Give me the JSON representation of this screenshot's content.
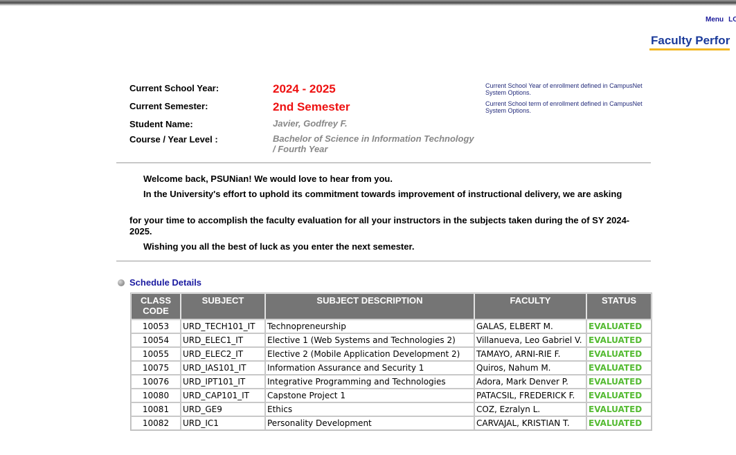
{
  "top_links": {
    "menu": "Menu",
    "logout": "LO"
  },
  "page_heading": "Faculty Perfor",
  "info": {
    "school_year_label": "Current School Year:",
    "school_year": "2024 - 2025",
    "semester_label": "Current Semester:",
    "semester": "2nd Semester",
    "student_label": "Student Name:",
    "student_name": "Javier, Godfrey F.",
    "course_label": "Course / Year Level :",
    "course_line1": "Bachelor of Science in Information Technology",
    "course_line2": "/ Fourth Year",
    "note_year": "Current School Year of enrollment defined in CampusNet System Options.",
    "note_term": "Current School term of enrollment defined in CampusNet System Options."
  },
  "message": {
    "welcome": "Welcome back, PSUNian! We would love to hear from you.",
    "effort": "In the University's effort to uphold its commitment towards improvement of instructional delivery, we are asking",
    "request": "for your time to accomplish the faculty evaluation for all your instructors in the subjects taken during the of SY 2024-2025.",
    "wish": "Wishing you all the best of luck as you enter the next semester."
  },
  "schedule": {
    "title": "Schedule Details",
    "headers": {
      "class_code": "CLASS CODE",
      "subject": "SUBJECT",
      "description": "SUBJECT DESCRIPTION",
      "faculty": "FACULTY",
      "status": "STATUS"
    },
    "rows": [
      {
        "code": "10053",
        "subject": "URD_TECH101_IT",
        "description": "Technopreneurship",
        "faculty": "GALAS, ELBERT M.",
        "status": "EVALUATED"
      },
      {
        "code": "10054",
        "subject": "URD_ELEC1_IT",
        "description": "Elective 1 (Web Systems and Technologies 2)",
        "faculty": "Villanueva, Leo Gabriel V.",
        "status": "EVALUATED"
      },
      {
        "code": "10055",
        "subject": "URD_ELEC2_IT",
        "description": "Elective 2 (Mobile Application Development 2)",
        "faculty": "TAMAYO, ARNI-RIE F.",
        "status": "EVALUATED"
      },
      {
        "code": "10075",
        "subject": "URD_IAS101_IT",
        "description": "Information Assurance and Security 1",
        "faculty": "Quiros, Nahum M.",
        "status": "EVALUATED"
      },
      {
        "code": "10076",
        "subject": "URD_IPT101_IT",
        "description": "Integrative Programming and Technologies",
        "faculty": "Adora, Mark Denver P.",
        "status": "EVALUATED"
      },
      {
        "code": "10080",
        "subject": "URD_CAP101_IT",
        "description": "Capstone Project 1",
        "faculty": "PATACSIL, FREDERICK F.",
        "status": "EVALUATED"
      },
      {
        "code": "10081",
        "subject": "URD_GE9",
        "description": "Ethics",
        "faculty": "COZ, Ezralyn L.",
        "status": "EVALUATED"
      },
      {
        "code": "10082",
        "subject": "URD_IC1",
        "description": "Personality Development",
        "faculty": "CARVAJAL, KRISTIAN T.",
        "status": "EVALUATED"
      }
    ]
  }
}
